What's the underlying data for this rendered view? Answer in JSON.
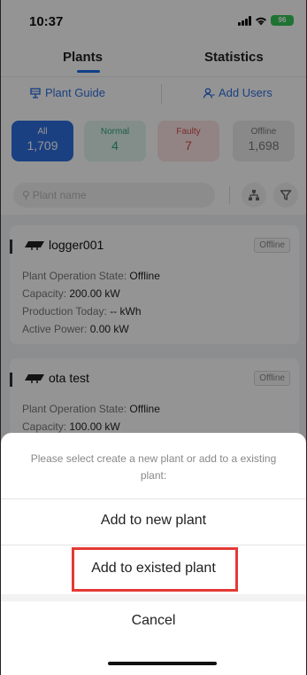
{
  "status_bar": {
    "time": "10:37",
    "battery": "96"
  },
  "tabs": {
    "plants": "Plants",
    "statistics": "Statistics"
  },
  "actions": {
    "plant_guide": "Plant Guide",
    "add_users": "Add Users"
  },
  "filters": [
    {
      "label": "All",
      "count": "1,709"
    },
    {
      "label": "Normal",
      "count": "4"
    },
    {
      "label": "Faulty",
      "count": "7"
    },
    {
      "label": "Offline",
      "count": "1,698"
    }
  ],
  "search": {
    "placeholder": "Plant name"
  },
  "plants": [
    {
      "name": "logger001",
      "badge": "Offline",
      "fields": [
        {
          "label": "Plant Operation State:",
          "value": "Offline"
        },
        {
          "label": "Capacity:",
          "value": "200.00 kW"
        },
        {
          "label": "Production Today:",
          "value": "-- kWh"
        },
        {
          "label": "Active Power:",
          "value": "0.00 kW"
        }
      ]
    },
    {
      "name": "ota test",
      "badge": "Offline",
      "fields": [
        {
          "label": "Plant Operation State:",
          "value": "Offline"
        },
        {
          "label": "Capacity:",
          "value": "100.00 kW"
        }
      ]
    }
  ],
  "sheet": {
    "message": "Please select create a new plant or add to a existing plant:",
    "option_new": "Add to new plant",
    "option_existing": "Add to existed plant",
    "cancel": "Cancel"
  },
  "colors": {
    "accent": "#1e6fe8",
    "highlight": "#e53935"
  }
}
